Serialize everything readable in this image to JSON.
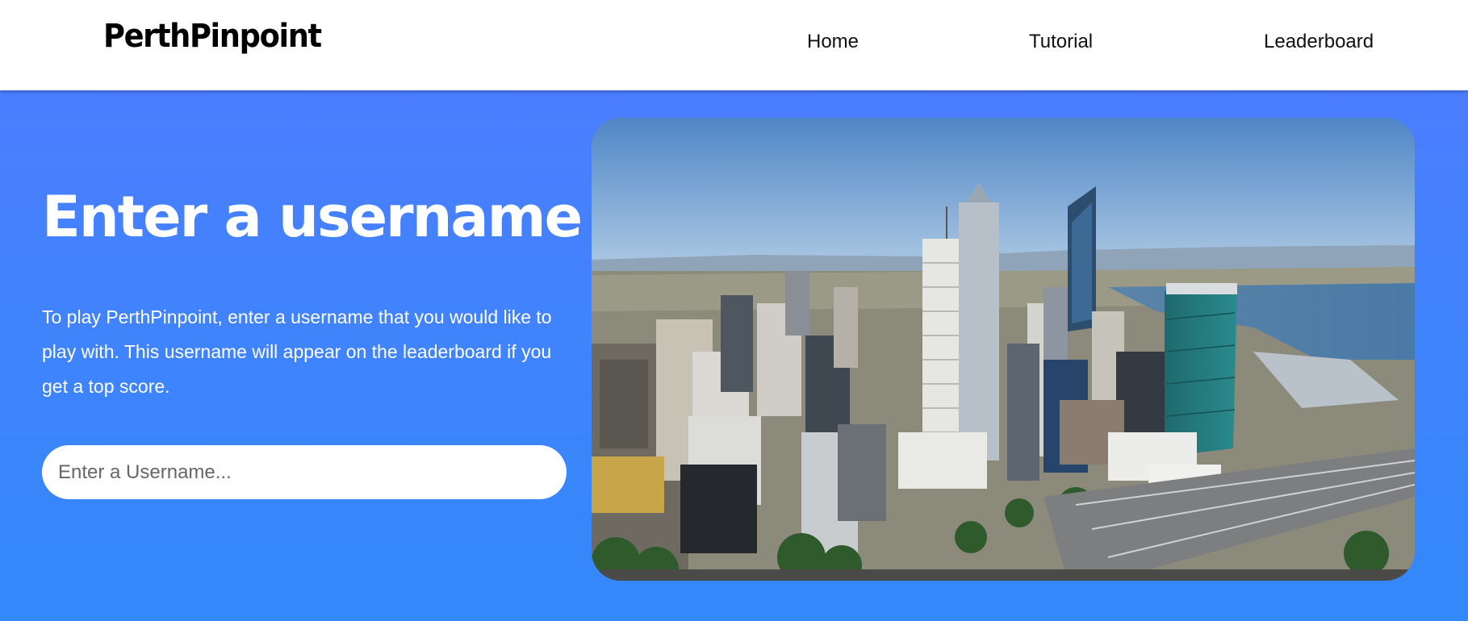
{
  "header": {
    "logo": "PerthPinpoint",
    "nav": {
      "home": "Home",
      "tutorial": "Tutorial",
      "leaderboard": "Leaderboard"
    }
  },
  "main": {
    "title": "Enter a username",
    "description": "To play PerthPinpoint, enter a username that you would like to play with. This username will appear on the leaderboard if you get a top score.",
    "username_input": {
      "placeholder": "Enter a Username...",
      "value": ""
    },
    "image": {
      "subject": "Aerial view of Perth city skyline beside the Swan River"
    }
  },
  "colors": {
    "hero_top": "#4b7efe",
    "hero_bottom": "#3388fa",
    "header_bg": "#ffffff"
  }
}
